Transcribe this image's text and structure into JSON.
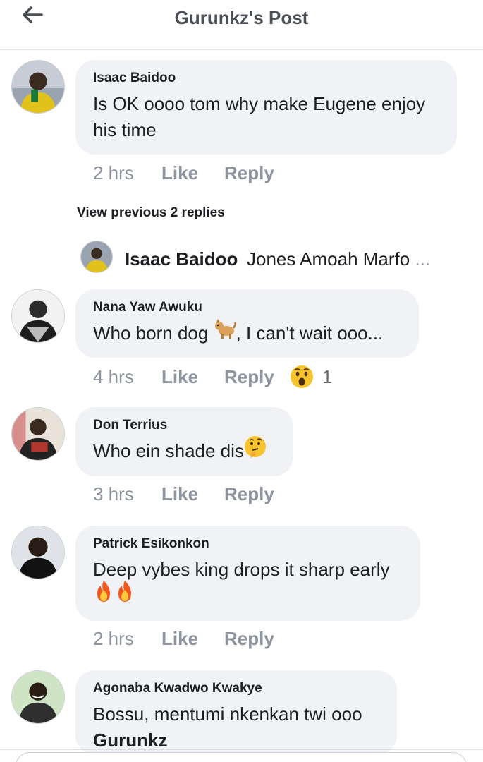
{
  "header": {
    "title": "Gurunkz's Post",
    "back_icon": "arrow-left-icon"
  },
  "comments": [
    {
      "author": "Isaac Baidoo",
      "text": "Is OK oooo tom why make Eugene enjoy his time",
      "time": "2 hrs",
      "like": "Like",
      "reply": "Reply"
    },
    {
      "author": "Nana Yaw Awuku",
      "text_before": "Who born dog ",
      "text_after": ", I can't wait ooo...",
      "emoji": "dog-emoji",
      "time": "4 hrs",
      "like": "Like",
      "reply": "Reply",
      "reaction": "wow-reaction-icon",
      "reaction_count": "1"
    },
    {
      "author": "Don Terrius",
      "text": "Who ein shade dis",
      "emoji": "thinking-face-emoji",
      "time": "3 hrs",
      "like": "Like",
      "reply": "Reply"
    },
    {
      "author": "Patrick Esikonkon",
      "text": "Deep vybes king drops it sharp early",
      "emoji": "fire-emoji",
      "time": "2 hrs",
      "like": "Like",
      "reply": "Reply"
    },
    {
      "author": "Agonaba Kwadwo Kwakye",
      "text": "Bossu, mentumi nkenkan twi ooo",
      "mention": "Gurunkz"
    }
  ],
  "view_previous": "View previous 2 replies",
  "reply_preview": {
    "author": "Isaac Baidoo",
    "text": "Jones Amoah Marfo",
    "ellipsis": "..."
  },
  "colors": {
    "bubble": "#f0f2f5",
    "meta": "#8d949e",
    "title": "#4b4f56"
  }
}
